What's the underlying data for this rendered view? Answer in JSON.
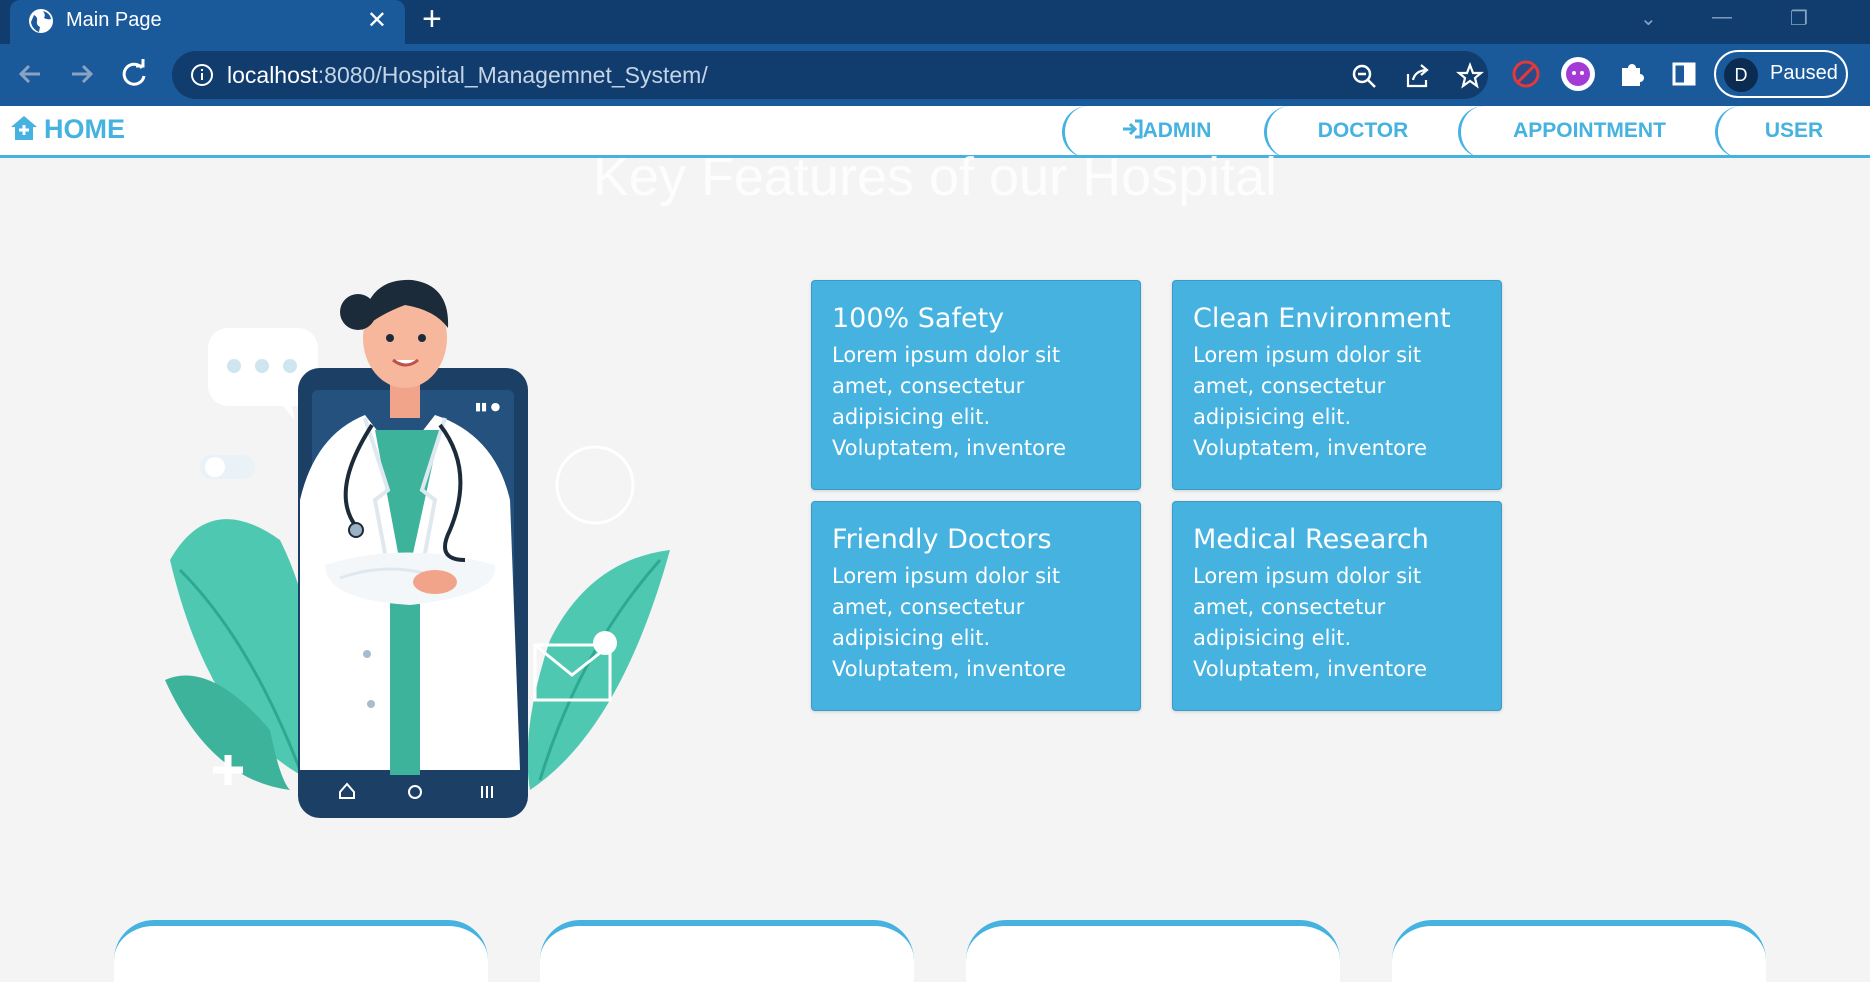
{
  "browser": {
    "tab_title": "Main Page",
    "url_host": "localhost",
    "url_rest": ":8080/Hospital_Managemnet_System/",
    "profile_initial": "D",
    "profile_status": "Paused"
  },
  "nav": {
    "home": "HOME",
    "admin": "ADMIN",
    "doctor": "DOCTOR",
    "appointment": "APPOINTMENT",
    "user": "USER"
  },
  "section_title": "Key Features of our Hospital",
  "features": [
    {
      "title": "100% Safety",
      "text": "Lorem ipsum dolor sit amet, consectetur adipisicing elit. Voluptatem, inventore"
    },
    {
      "title": "Clean Environment",
      "text": "Lorem ipsum dolor sit amet, consectetur adipisicing elit. Voluptatem, inventore"
    },
    {
      "title": "Friendly Doctors",
      "text": "Lorem ipsum dolor sit amet, consectetur adipisicing elit. Voluptatem, inventore"
    },
    {
      "title": "Medical Research",
      "text": "Lorem ipsum dolor sit amet, consectetur adipisicing elit. Voluptatem, inventore"
    }
  ],
  "colors": {
    "accent": "#45b2e0",
    "chrome_dark": "#103c6e",
    "chrome": "#1a5a9a",
    "page_bg": "#f4f4f4"
  }
}
